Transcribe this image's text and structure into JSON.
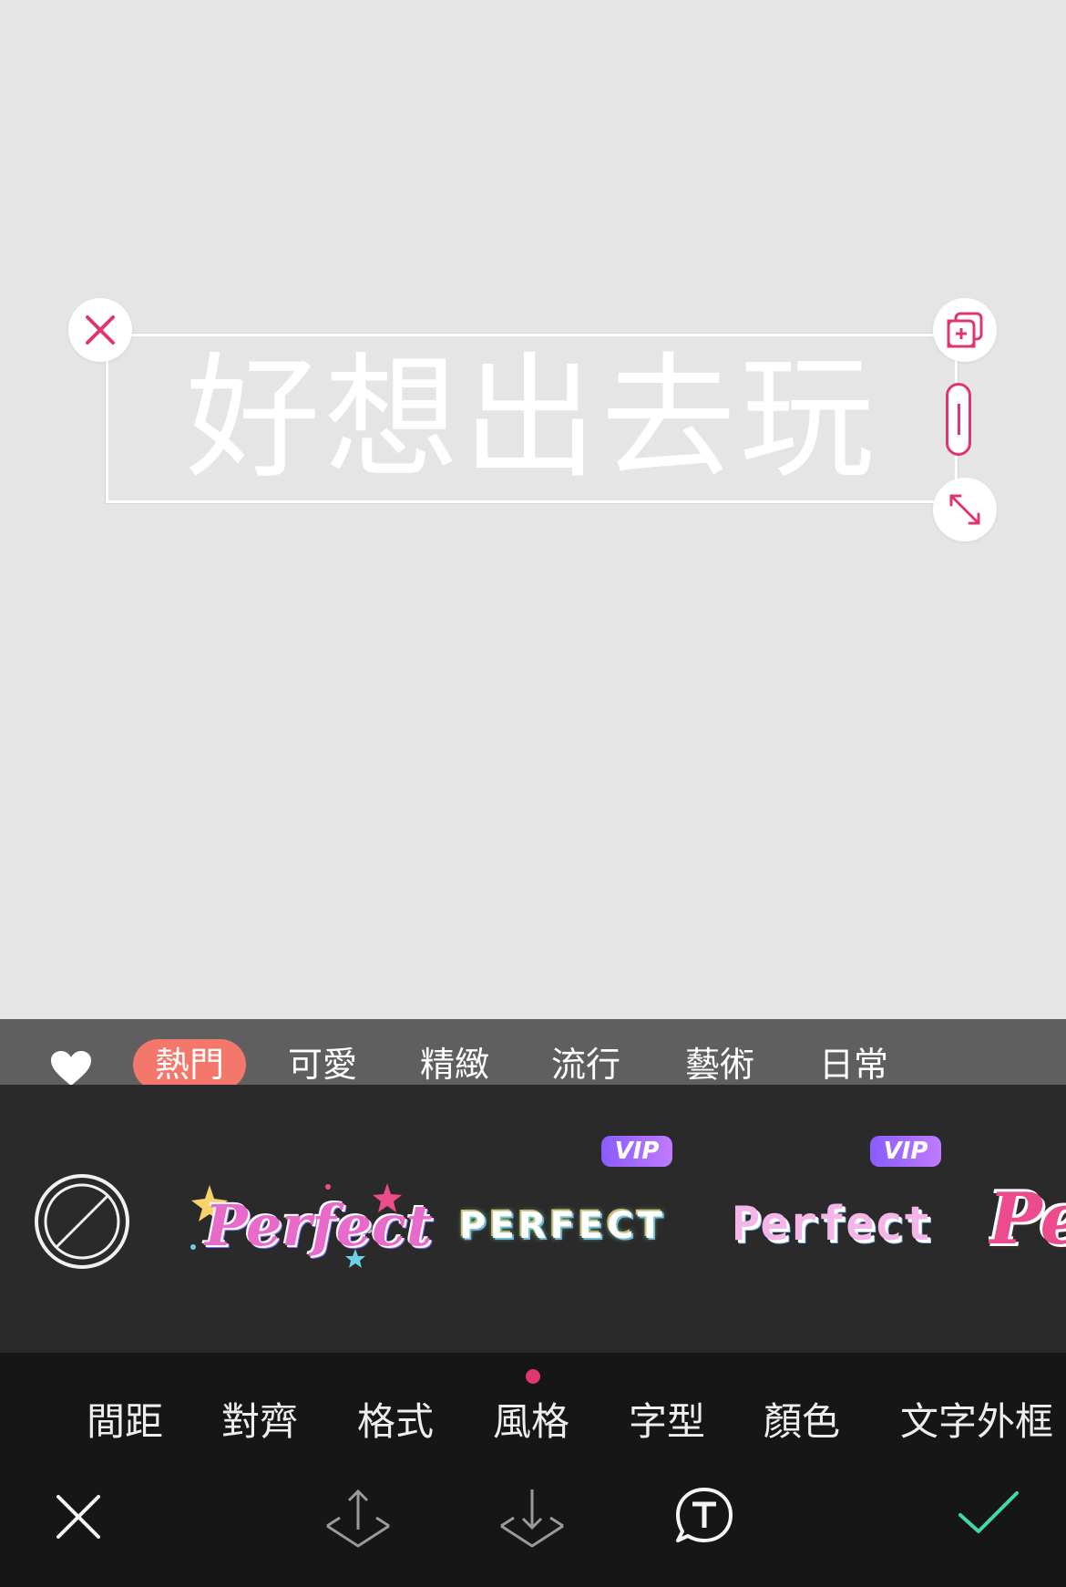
{
  "canvas": {
    "text": "好想出去玩"
  },
  "categories": {
    "items": [
      {
        "label": "熱門",
        "active": true
      },
      {
        "label": "可愛",
        "active": false
      },
      {
        "label": "精緻",
        "active": false
      },
      {
        "label": "流行",
        "active": false
      },
      {
        "label": "藝術",
        "active": false
      },
      {
        "label": "日常",
        "active": false
      }
    ]
  },
  "styles": {
    "items": [
      {
        "label": "Perfect",
        "vip": false
      },
      {
        "label": "PERFECT",
        "vip": true,
        "vip_label": "VIP"
      },
      {
        "label": "Perfect",
        "vip": true,
        "vip_label": "VIP"
      },
      {
        "label": "Pe",
        "vip": false
      }
    ]
  },
  "tools": {
    "items": [
      {
        "label": "間距"
      },
      {
        "label": "對齊"
      },
      {
        "label": "格式"
      },
      {
        "label": "風格",
        "active": true
      },
      {
        "label": "字型"
      },
      {
        "label": "顏色"
      },
      {
        "label": "文字外框"
      }
    ]
  },
  "colors": {
    "accent": "#e0356f",
    "active_category": "#f4776c",
    "confirm": "#3fd9a8",
    "vip": "#9a66ff"
  }
}
